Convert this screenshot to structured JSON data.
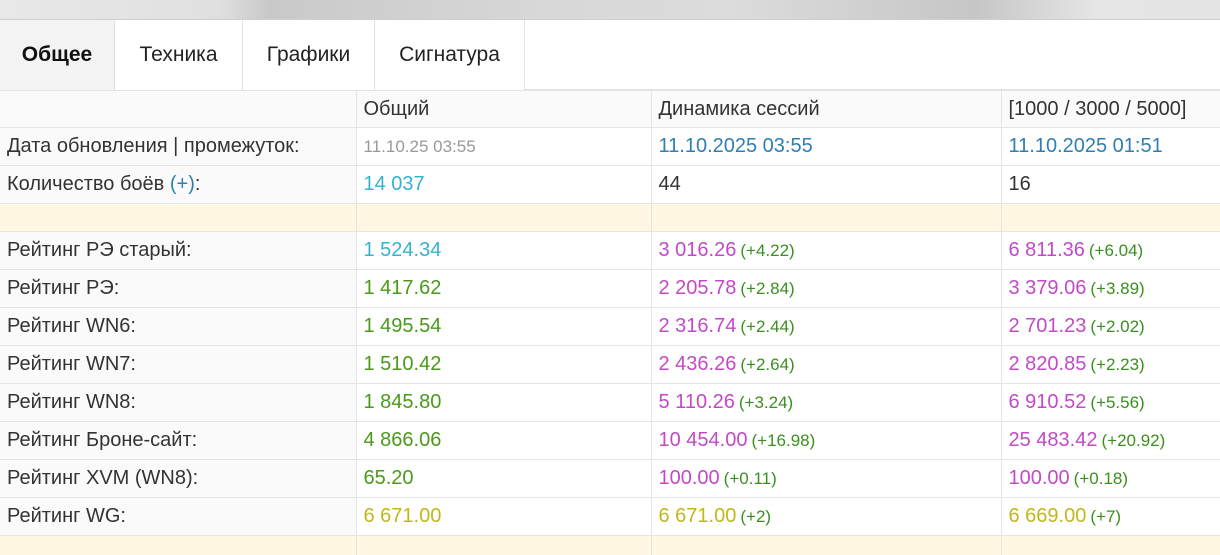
{
  "tabs": [
    {
      "label": "Общее",
      "active": true
    },
    {
      "label": "Техника",
      "active": false
    },
    {
      "label": "Графики",
      "active": false
    },
    {
      "label": "Сигнатура",
      "active": false
    }
  ],
  "table": {
    "header": {
      "col_total": "Общий",
      "col_sessions": "Динамика сессий",
      "col_ranges": "[1000 / 3000 / 5000]"
    },
    "update_row": {
      "label": "Дата обновления | промежуток:",
      "total": "11.10.25 03:55",
      "sessions": "11.10.2025 03:55",
      "ranges": "11.10.2025 01:51"
    },
    "battles_row": {
      "label": "Количество боёв",
      "plus": "(+)",
      "colon": ":",
      "total": "14 037",
      "sessions": "44",
      "ranges": "16"
    },
    "ratings": [
      {
        "label": "Рейтинг РЭ старый:",
        "total": "1 524.34",
        "sessions": "3 016.26",
        "sessions_delta": "(+4.22)",
        "ranges": "6 811.36",
        "ranges_delta": "(+6.04)"
      },
      {
        "label": "Рейтинг РЭ:",
        "total": "1 417.62",
        "sessions": "2 205.78",
        "sessions_delta": "(+2.84)",
        "ranges": "3 379.06",
        "ranges_delta": "(+3.89)"
      },
      {
        "label": "Рейтинг WN6:",
        "total": "1 495.54",
        "sessions": "2 316.74",
        "sessions_delta": "(+2.44)",
        "ranges": "2 701.23",
        "ranges_delta": "(+2.02)"
      },
      {
        "label": "Рейтинг WN7:",
        "total": "1 510.42",
        "sessions": "2 436.26",
        "sessions_delta": "(+2.64)",
        "ranges": "2 820.85",
        "ranges_delta": "(+2.23)"
      },
      {
        "label": "Рейтинг WN8:",
        "total": "1 845.80",
        "sessions": "5 110.26",
        "sessions_delta": "(+3.24)",
        "ranges": "6 910.52",
        "ranges_delta": "(+5.56)"
      },
      {
        "label": "Рейтинг Броне-сайт:",
        "total": "4 866.06",
        "sessions": "10 454.00",
        "sessions_delta": "(+16.98)",
        "ranges": "25 483.42",
        "ranges_delta": "(+20.92)"
      },
      {
        "label": "Рейтинг XVM (WN8):",
        "total": "65.20",
        "sessions": "100.00",
        "sessions_delta": "(+0.11)",
        "ranges": "100.00",
        "ranges_delta": "(+0.18)"
      },
      {
        "label": "Рейтинг WG:",
        "total": "6 671.00",
        "sessions": "6 671.00",
        "sessions_delta": "(+2)",
        "ranges": "6 669.00",
        "ranges_delta": "(+7)"
      }
    ]
  },
  "colors": {
    "link_blue": "#2f7fb0",
    "cyan": "#34b3d1",
    "green": "#4a9a1a",
    "purple": "#c349c9",
    "yellow": "#c1b71c",
    "spacer": "#fff7e1"
  }
}
